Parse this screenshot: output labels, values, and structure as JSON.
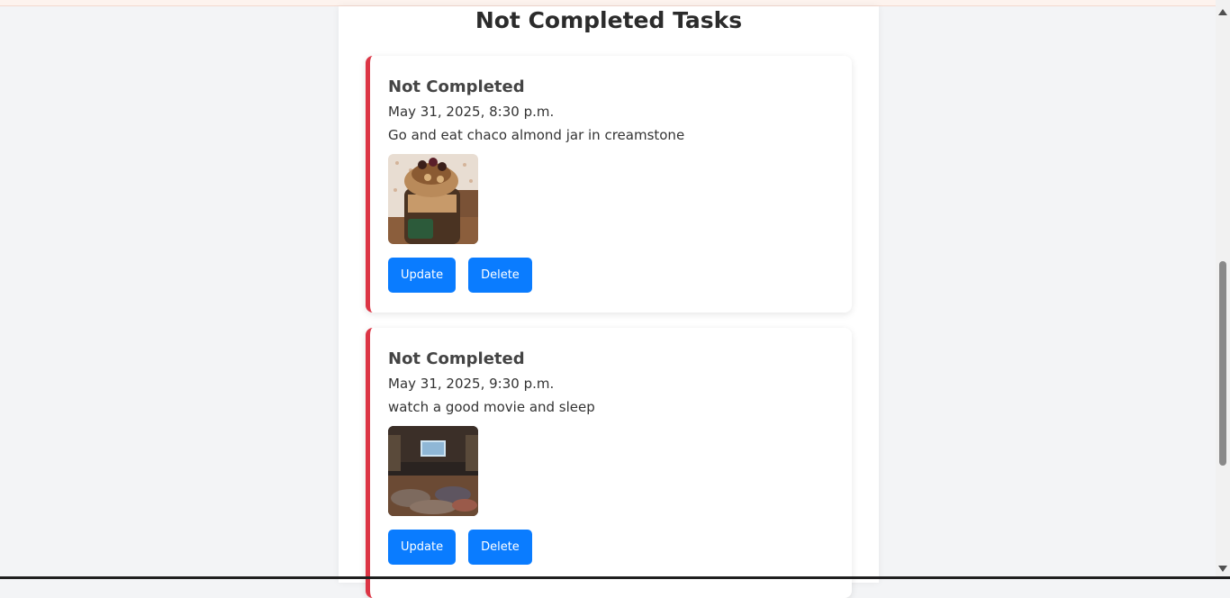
{
  "section": {
    "title": "Not Completed Tasks"
  },
  "tasks": [
    {
      "status": "Not Completed",
      "datetime": "May 31, 2025, 8:30 p.m.",
      "description": "Go and eat chaco almond jar in creamstone",
      "image": "dessert-jar-photo",
      "update_label": "Update",
      "delete_label": "Delete"
    },
    {
      "status": "Not Completed",
      "datetime": "May 31, 2025, 9:30 p.m.",
      "description": "watch a good movie and sleep",
      "image": "home-theater-photo",
      "update_label": "Update",
      "delete_label": "Delete"
    }
  ],
  "colors": {
    "accent_border": "#dc3545",
    "button": "#0a7cff",
    "page_bg": "#f3f4f6"
  }
}
